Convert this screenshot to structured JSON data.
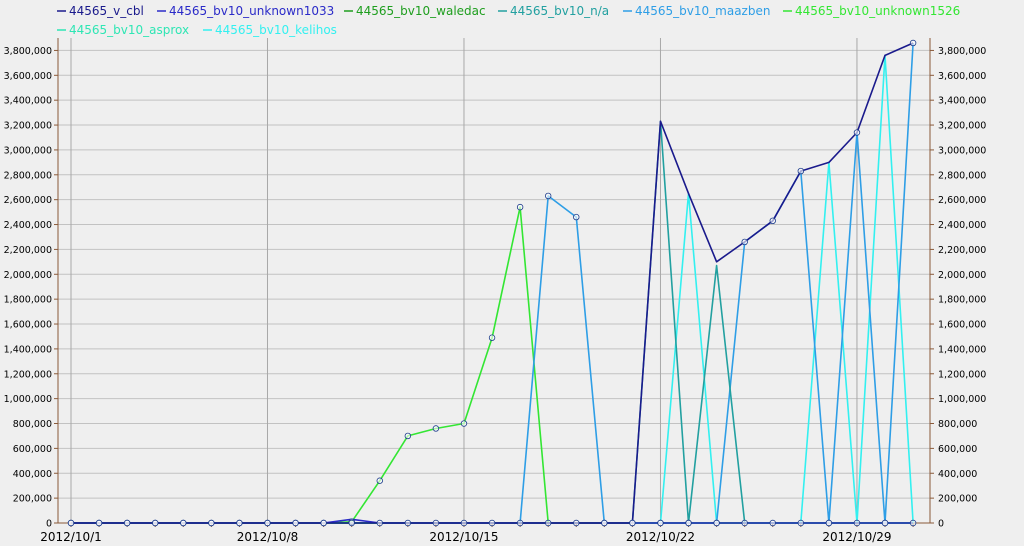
{
  "chart_data": {
    "type": "line",
    "title": "",
    "xlabel": "",
    "ylabel": "",
    "ylim": [
      0,
      3900000
    ],
    "y_ticks": [
      0,
      200000,
      400000,
      600000,
      800000,
      1000000,
      1200000,
      1400000,
      1600000,
      1800000,
      2000000,
      2200000,
      2400000,
      2600000,
      2800000,
      3000000,
      3200000,
      3400000,
      3600000,
      3800000
    ],
    "x": [
      "2012/10/1",
      "2012/10/2",
      "2012/10/3",
      "2012/10/4",
      "2012/10/5",
      "2012/10/6",
      "2012/10/7",
      "2012/10/8",
      "2012/10/9",
      "2012/10/10",
      "2012/10/11",
      "2012/10/12",
      "2012/10/13",
      "2012/10/14",
      "2012/10/15",
      "2012/10/16",
      "2012/10/17",
      "2012/10/18",
      "2012/10/19",
      "2012/10/20",
      "2012/10/21",
      "2012/10/22",
      "2012/10/23",
      "2012/10/24",
      "2012/10/25",
      "2012/10/26",
      "2012/10/27",
      "2012/10/28",
      "2012/10/29",
      "2012/10/30",
      "2012/10/31"
    ],
    "x_tick_labels": [
      {
        "index": 0,
        "label": "2012/10/1"
      },
      {
        "index": 7,
        "label": "2012/10/8"
      },
      {
        "index": 14,
        "label": "2012/10/15"
      },
      {
        "index": 21,
        "label": "2012/10/22"
      },
      {
        "index": 28,
        "label": "2012/10/29"
      }
    ],
    "grid": true,
    "legend_position": "top",
    "series": [
      {
        "name": "44565_v_cbl",
        "color": "#1a1a8c",
        "markers": false,
        "values": [
          0,
          0,
          0,
          0,
          0,
          0,
          0,
          0,
          0,
          0,
          0,
          0,
          0,
          0,
          0,
          0,
          0,
          0,
          0,
          0,
          0,
          3230000,
          2650000,
          2100000,
          2260000,
          2430000,
          2830000,
          2900000,
          3140000,
          3760000,
          3860000
        ]
      },
      {
        "name": "44565_bv10_unknown1033",
        "color": "#2a2ac8",
        "markers": false,
        "values": [
          0,
          0,
          0,
          0,
          0,
          0,
          0,
          0,
          0,
          0,
          30000,
          0,
          0,
          0,
          0,
          0,
          0,
          0,
          0,
          0,
          0,
          0,
          0,
          0,
          0,
          0,
          0,
          0,
          0,
          0,
          0
        ]
      },
      {
        "name": "44565_bv10_waledac",
        "color": "#1e9e1e",
        "markers": false,
        "values": [
          0,
          0,
          0,
          0,
          0,
          0,
          0,
          0,
          0,
          0,
          0,
          0,
          0,
          0,
          0,
          0,
          0,
          0,
          0,
          0,
          0,
          0,
          0,
          0,
          0,
          0,
          0,
          0,
          0,
          0,
          0
        ]
      },
      {
        "name": "44565_bv10_n/a",
        "color": "#22a0a0",
        "markers": false,
        "values": [
          0,
          0,
          0,
          0,
          0,
          0,
          0,
          0,
          0,
          0,
          0,
          0,
          0,
          0,
          0,
          0,
          0,
          0,
          0,
          0,
          0,
          3230000,
          0,
          2070000,
          0,
          0,
          0,
          0,
          0,
          0,
          0
        ]
      },
      {
        "name": "44565_bv10_maazben",
        "color": "#2e9ee6",
        "markers": true,
        "values": [
          0,
          0,
          0,
          0,
          0,
          0,
          0,
          0,
          0,
          0,
          0,
          0,
          0,
          0,
          0,
          0,
          0,
          2630000,
          2460000,
          0,
          0,
          0,
          0,
          0,
          2260000,
          2430000,
          2830000,
          0,
          3140000,
          0,
          3860000
        ]
      },
      {
        "name": "44565_bv10_unknown1526",
        "color": "#33e633",
        "markers": true,
        "values": [
          0,
          0,
          0,
          0,
          0,
          0,
          0,
          0,
          0,
          0,
          10000,
          340000,
          700000,
          760000,
          800000,
          1490000,
          2540000,
          0,
          0,
          0,
          0,
          0,
          0,
          0,
          0,
          0,
          0,
          0,
          0,
          0,
          0
        ]
      },
      {
        "name": "44565_bv10_asprox",
        "color": "#2ee6b4",
        "markers": false,
        "values": [
          0,
          0,
          0,
          0,
          0,
          0,
          0,
          0,
          0,
          0,
          0,
          0,
          0,
          0,
          0,
          0,
          0,
          0,
          0,
          0,
          0,
          0,
          0,
          0,
          0,
          0,
          0,
          0,
          0,
          0,
          0
        ]
      },
      {
        "name": "44565_bv10_kelihos",
        "color": "#33f0f0",
        "markers": false,
        "values": [
          0,
          0,
          0,
          0,
          0,
          0,
          0,
          0,
          0,
          0,
          0,
          0,
          0,
          0,
          0,
          0,
          0,
          0,
          0,
          0,
          0,
          0,
          2650000,
          0,
          0,
          0,
          0,
          2900000,
          0,
          3760000,
          0
        ]
      }
    ]
  }
}
